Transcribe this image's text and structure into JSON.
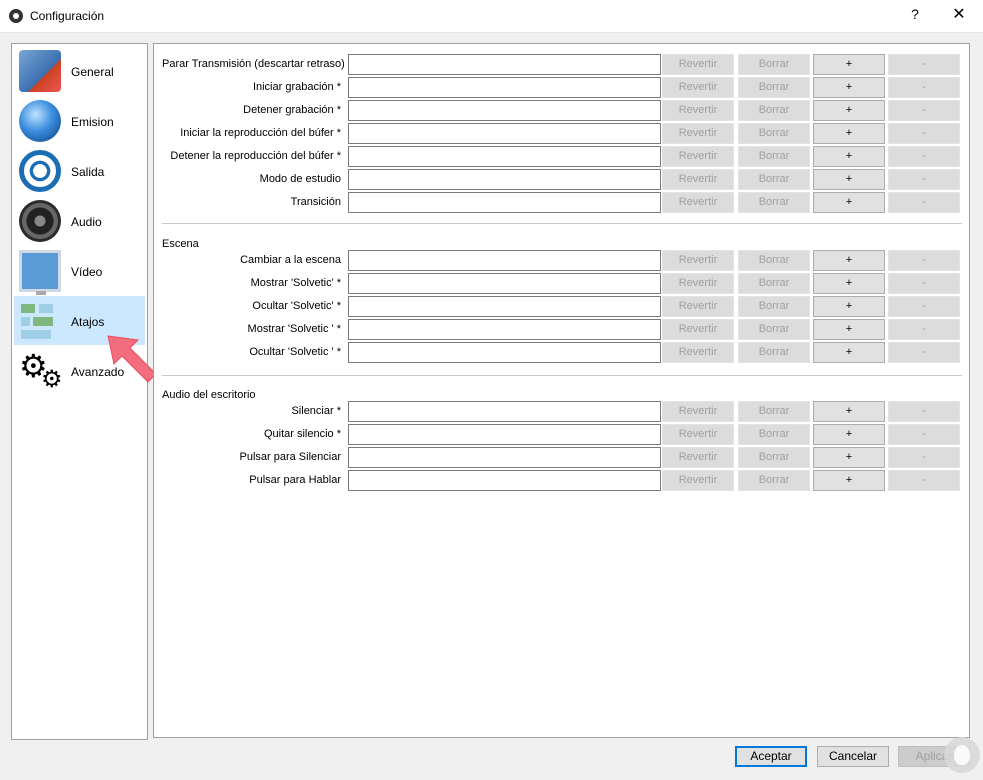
{
  "window": {
    "title": "Configuración",
    "help": "?",
    "close": "✕"
  },
  "sidebar": {
    "items": [
      {
        "label": "General",
        "icon": "general-icon"
      },
      {
        "label": "Emision",
        "icon": "emision-icon"
      },
      {
        "label": "Salida",
        "icon": "salida-icon"
      },
      {
        "label": "Audio",
        "icon": "audio-icon"
      },
      {
        "label": "Vídeo",
        "icon": "video-icon"
      },
      {
        "label": "Atajos",
        "icon": "atajos-icon",
        "selected": true
      },
      {
        "label": "Avanzado",
        "icon": "gears-icon"
      }
    ]
  },
  "buttons": {
    "revert": "Revertir",
    "clear": "Borrar",
    "add": "+",
    "remove": "-"
  },
  "groups": {
    "general": {
      "rows": [
        "Parar Transmisión (descartar retraso)",
        "Iniciar grabación *",
        "Detener grabación *",
        "Iniciar la reproducción del búfer *",
        "Detener la reproducción del búfer *",
        "Modo de estudio",
        "Transición"
      ]
    },
    "escena": {
      "title": "Escena",
      "rows": [
        "Cambiar a la escena",
        "Mostrar 'Solvetic' *",
        "Ocultar 'Solvetic' *",
        "Mostrar 'Solvetic ' *",
        "Ocultar 'Solvetic ' *"
      ]
    },
    "audio": {
      "title": "Audio del escritorio",
      "rows": [
        "Silenciar *",
        "Quitar silencio *",
        "Pulsar para Silenciar",
        "Pulsar para Hablar"
      ]
    }
  },
  "footer": {
    "accept": "Aceptar",
    "cancel": "Cancelar",
    "apply": "Aplicar"
  },
  "colors": {
    "selection": "#cce8ff",
    "arrow": "#f26d7d",
    "accent": "#0078d7"
  }
}
